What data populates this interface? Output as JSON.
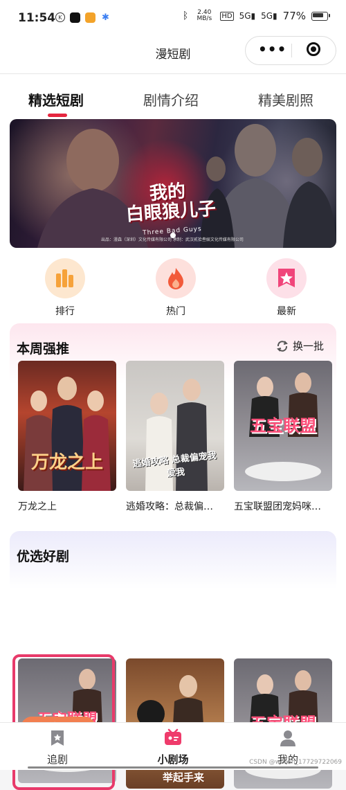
{
  "status_bar": {
    "time": "11:54",
    "speed": "2.40 MB/s",
    "battery": "77%"
  },
  "header": {
    "title": "漫短剧"
  },
  "tabs": [
    {
      "label": "精选短剧",
      "active": true
    },
    {
      "label": "剧情介绍",
      "active": false
    },
    {
      "label": "精美剧照",
      "active": false
    }
  ],
  "banner": {
    "show_title_line1": "我的",
    "show_title_line2": "白眼狼儿子",
    "show_subtitle": "Three Bad Guys",
    "credits": "出品：漫森（深圳）文化传媒有限公司   承制：武汉贰拾叁娱文化传媒有限公司"
  },
  "quick_links": [
    {
      "label": "排行",
      "icon": "bar-chart-icon",
      "color": "#f6a23a"
    },
    {
      "label": "热门",
      "icon": "flame-icon",
      "color": "#f25a3a"
    },
    {
      "label": "最新",
      "icon": "star-badge-icon",
      "color": "#f0457a"
    }
  ],
  "weekly": {
    "title": "本周强推",
    "refresh_label": "换一批",
    "items": [
      {
        "label": "万龙之上",
        "poster_text": "万龙之上"
      },
      {
        "label": "逃婚攻略：总裁偏…",
        "poster_text": "逃婚攻略 总裁偏宠我爱我"
      },
      {
        "label": "五宝联盟团宠妈咪…",
        "poster_text": "五宝联盟"
      }
    ]
  },
  "picks": {
    "title": "优选好剧",
    "continue_label": "继续观看",
    "items": [
      {
        "poster_text": "五宝联盟"
      },
      {
        "poster_text": "雷霆四宝 爹地举起手来"
      },
      {
        "poster_text": "五宝联盟"
      }
    ]
  },
  "bottom_nav": [
    {
      "label": "追剧",
      "icon": "bookmark-icon",
      "active": false
    },
    {
      "label": "小剧场",
      "icon": "theater-icon",
      "active": true
    },
    {
      "label": "我的",
      "icon": "user-icon",
      "active": false
    }
  ],
  "watermark": "CSDN @weixin_17729722069",
  "colors": {
    "accent": "#e6263f",
    "continue_button": "#f27f50",
    "active_frame": "#e83a6a"
  }
}
